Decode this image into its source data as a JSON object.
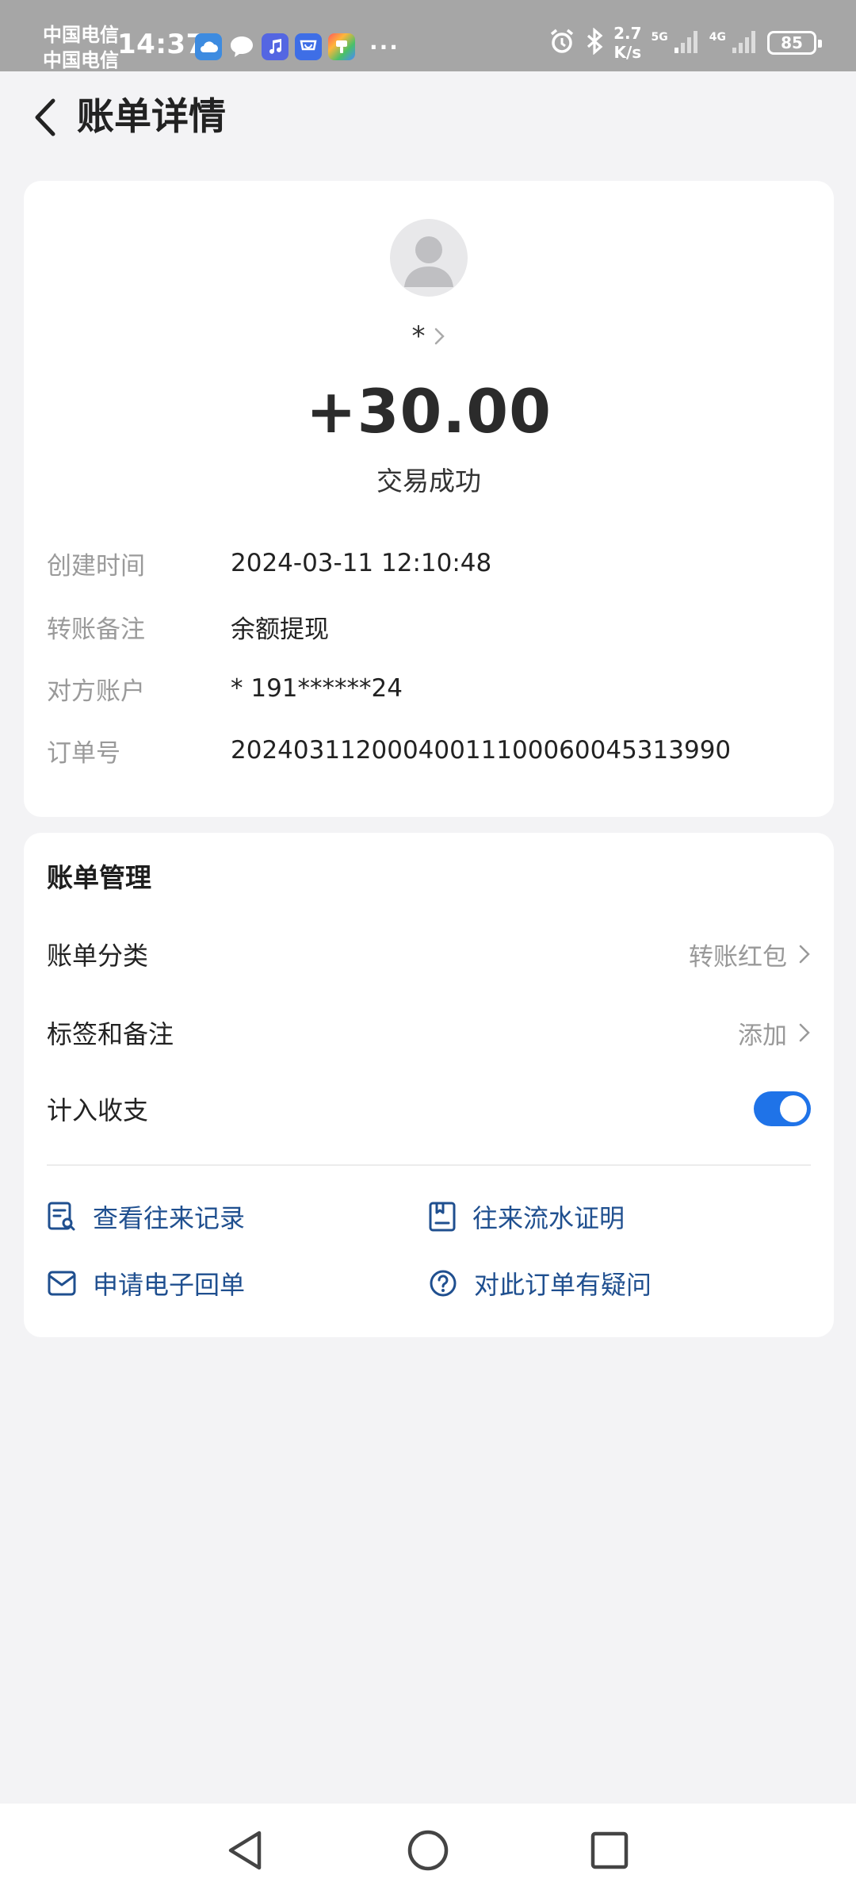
{
  "status_bar": {
    "carrier_line1": "中国电信",
    "carrier_line2": "中国电信",
    "time": "14:37",
    "net_speed_value": "2.7",
    "net_speed_unit": "K/s",
    "signal1_label": "5G",
    "signal2_label": "4G",
    "battery": "85"
  },
  "header": {
    "title": "账单详情"
  },
  "summary": {
    "counterparty": "*",
    "amount": "+30.00",
    "status": "交易成功"
  },
  "details": [
    {
      "label": "创建时间",
      "value": "2024-03-11 12:10:48"
    },
    {
      "label": "转账备注",
      "value": "余额提现"
    },
    {
      "label": "对方账户",
      "value": "* 191******24"
    },
    {
      "label": "订单号",
      "value": "20240311200040011100060045313990"
    }
  ],
  "management": {
    "title": "账单管理",
    "category_label": "账单分类",
    "category_value": "转账红包",
    "tags_label": "标签和备注",
    "tags_value": "添加",
    "include_label": "计入收支",
    "include_enabled": true
  },
  "actions": {
    "history": "查看往来记录",
    "statement": "往来流水证明",
    "receipt": "申请电子回单",
    "question": "对此订单有疑问"
  },
  "colors": {
    "accent": "#1f73e8",
    "link": "#1f4f8f",
    "background": "#f3f3f5"
  }
}
